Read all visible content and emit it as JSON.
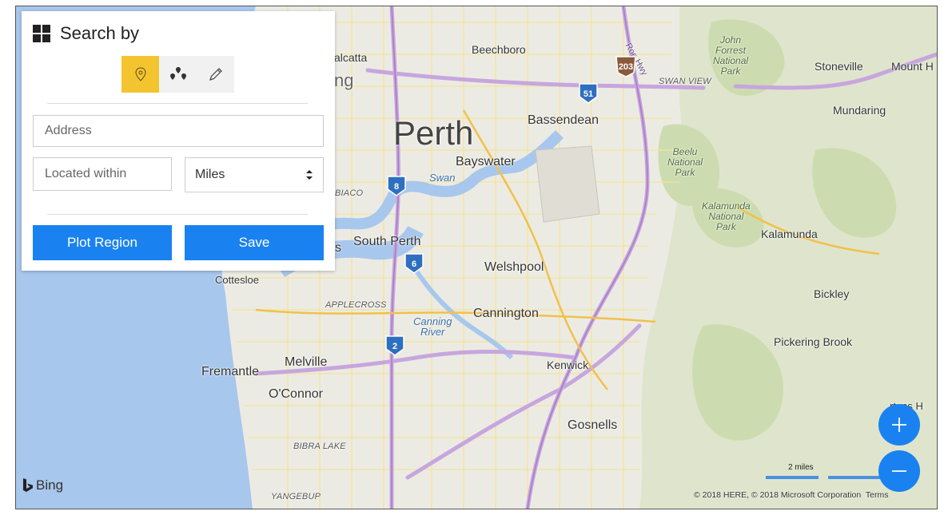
{
  "panel": {
    "title": "Search by",
    "modes": [
      {
        "name": "location-pin-icon",
        "active": true
      },
      {
        "name": "multi-pin-icon",
        "active": false
      },
      {
        "name": "pencil-icon",
        "active": false
      }
    ],
    "address_placeholder": "Address",
    "located_within_placeholder": "Located within",
    "unit_selected": "Miles",
    "plot_region_label": "Plot Region",
    "save_label": "Save"
  },
  "map": {
    "city": "Perth",
    "places": {
      "beechboro": "Beechboro",
      "bassendean": "Bassendean",
      "bayswater": "Bayswater",
      "south_perth": "South Perth",
      "welshpool": "Welshpool",
      "cannington": "Cannington",
      "cottesloe": "Cottesloe",
      "melville": "Melville",
      "fremantle": "Fremantle",
      "oconnor": "O'Connor",
      "kenwick": "Kenwick",
      "gosnells": "Gosnells",
      "stoneville": "Stoneville",
      "mount_h": "Mount H",
      "mundaring": "Mundaring",
      "kalamunda": "Kalamunda",
      "bickley": "Bickley",
      "pickering_brook": "Pickering Brook",
      "partial_alcatta": "alcatta",
      "partial_ng": "ng",
      "partial_s": "s",
      "partial_burtons": "rtons H"
    },
    "suburbs": {
      "swan_view": "SWAN VIEW",
      "biaco": "BIACO",
      "applecross": "APPLECROSS",
      "bibra_lake": "BIBRA LAKE",
      "yangebup": "YANGEBUP"
    },
    "parks": {
      "john_forrest": "John\nForrest\nNational\nPark",
      "beelu": "Beelu\nNational\nPark",
      "kalamunda_np": "Kalamunda\nNational\nPark"
    },
    "water": {
      "swan": "Swan",
      "canning": "Canning\nRiver"
    },
    "roe_hwy": "Roe Hwy",
    "shields": [
      "203",
      "51",
      "8",
      "6",
      "2"
    ],
    "bing_label": "Bing",
    "attribution": "© 2018 HERE, © 2018 Microsoft Corporation",
    "terms_label": "Terms",
    "scale_label": "2 miles"
  }
}
